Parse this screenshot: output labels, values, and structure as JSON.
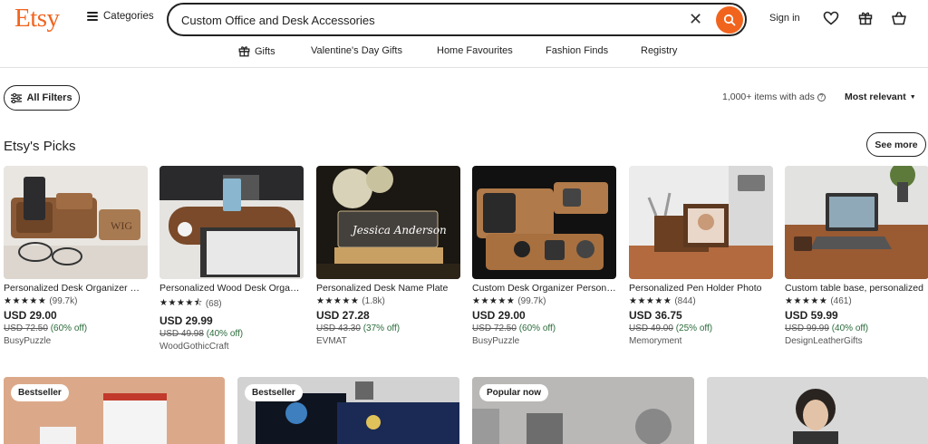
{
  "header": {
    "logo": "Etsy",
    "categories_label": "Categories",
    "search_value": "Custom Office and Desk Accessories",
    "signin_label": "Sign in",
    "brand_color": "#F1641E"
  },
  "subnav": {
    "gifts": "Gifts",
    "valentines": "Valentine's Day Gifts",
    "home": "Home Favourites",
    "fashion": "Fashion Finds",
    "registry": "Registry"
  },
  "filters": {
    "all_filters": "All Filters",
    "items_count": "1,000+ items with ads",
    "sort": "Most relevant"
  },
  "picks": {
    "title": "Etsy's Picks",
    "see_more": "See more",
    "products": [
      {
        "title": "Personalized Desk Organizer Wood",
        "stars": "★★★★★",
        "reviews": "(99.7k)",
        "price": "USD 29.00",
        "orig": "USD 72.50",
        "discount": "(60% off)",
        "shop": "BusyPuzzle"
      },
      {
        "title": "Personalized Wood Desk Organizer",
        "stars": "★★★★⯪",
        "reviews": "(68)",
        "price": "USD 29.99",
        "orig": "USD 49.98",
        "discount": "(40% off)",
        "shop": "WoodGothicCraft"
      },
      {
        "title": "Personalized Desk Name Plate",
        "stars": "★★★★★",
        "reviews": "(1.8k)",
        "price": "USD 27.28",
        "orig": "USD 43.30",
        "discount": "(37% off)",
        "shop": "EVMAT"
      },
      {
        "title": "Custom Desk Organizer Personalized",
        "stars": "★★★★★",
        "reviews": "(99.7k)",
        "price": "USD 29.00",
        "orig": "USD 72.50",
        "discount": "(60% off)",
        "shop": "BusyPuzzle"
      },
      {
        "title": "Personalized Pen Holder Photo",
        "stars": "★★★★★",
        "reviews": "(844)",
        "price": "USD 36.75",
        "orig": "USD 49.00",
        "discount": "(25% off)",
        "shop": "Memoryment"
      },
      {
        "title": "Custom table base, personalized",
        "stars": "★★★★★",
        "reviews": "(461)",
        "price": "USD 59.99",
        "orig": "USD 99.99",
        "discount": "(40% off)",
        "shop": "DesignLeatherGifts"
      }
    ]
  },
  "bottom": {
    "badges": [
      "Bestseller",
      "Bestseller",
      "Popular now"
    ]
  }
}
